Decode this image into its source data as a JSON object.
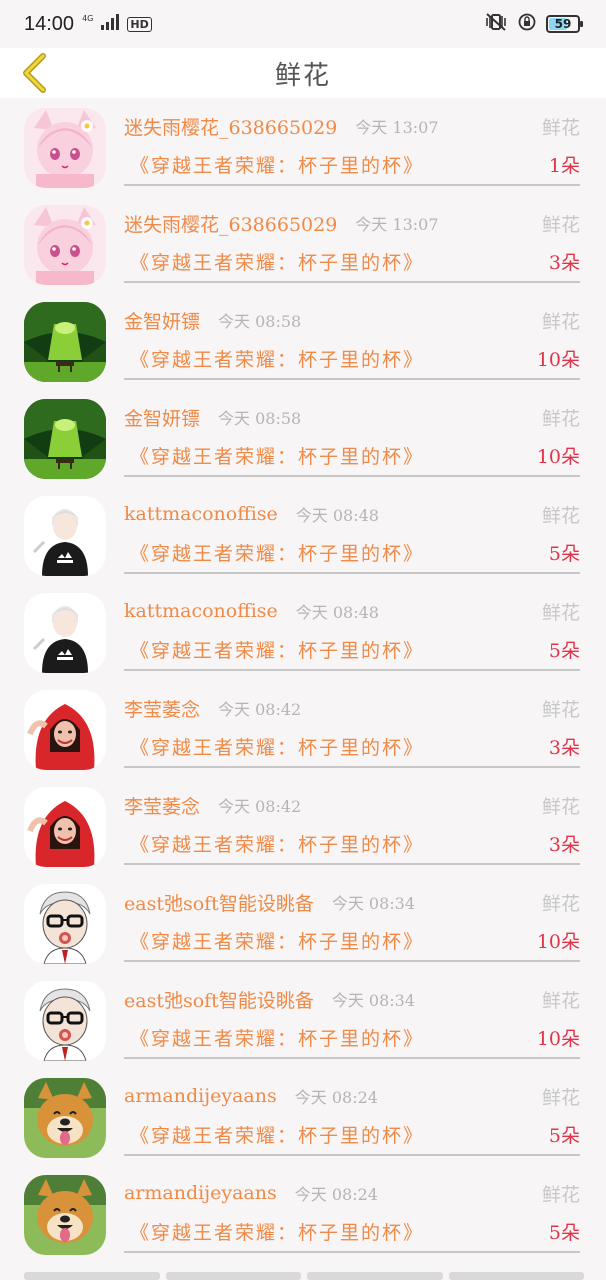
{
  "status_bar": {
    "time": "14:00",
    "network_type": "4G",
    "hd_label": "HD",
    "battery": "59",
    "battery_level": 0.59
  },
  "header": {
    "title": "鲜花",
    "back_icon": "chevron-left-icon"
  },
  "colors": {
    "accent": "#f08a46",
    "count": "#e0344b",
    "muted": "#b5b5b5"
  },
  "items": [
    {
      "username": "迷失雨樱花_638665029",
      "time": "今天 13:07",
      "gift": "鲜花",
      "book": "《穿越王者荣耀：杯子里的杯》",
      "count": "1朵",
      "avatar": "anime-girl-avatar"
    },
    {
      "username": "迷失雨樱花_638665029",
      "time": "今天 13:07",
      "gift": "鲜花",
      "book": "《穿越王者荣耀：杯子里的杯》",
      "count": "3朵",
      "avatar": "anime-girl-avatar"
    },
    {
      "username": "金智妍镖",
      "time": "今天 08:58",
      "gift": "鲜花",
      "book": "《穿越王者荣耀：杯子里的杯》",
      "count": "10朵",
      "avatar": "forest-avatar"
    },
    {
      "username": "金智妍镖",
      "time": "今天 08:58",
      "gift": "鲜花",
      "book": "《穿越王者荣耀：杯子里的杯》",
      "count": "10朵",
      "avatar": "forest-avatar"
    },
    {
      "username": "kattmaconoffise",
      "time": "今天 08:48",
      "gift": "鲜花",
      "book": "《穿越王者荣耀：杯子里的杯》",
      "count": "5朵",
      "avatar": "man-avatar"
    },
    {
      "username": "kattmaconoffise",
      "time": "今天 08:48",
      "gift": "鲜花",
      "book": "《穿越王者荣耀：杯子里的杯》",
      "count": "5朵",
      "avatar": "man-avatar"
    },
    {
      "username": "李莹萎念",
      "time": "今天 08:42",
      "gift": "鲜花",
      "book": "《穿越王者荣耀：杯子里的杯》",
      "count": "3朵",
      "avatar": "woman-red-hood-avatar"
    },
    {
      "username": "李莹萎念",
      "time": "今天 08:42",
      "gift": "鲜花",
      "book": "《穿越王者荣耀：杯子里的杯》",
      "count": "3朵",
      "avatar": "woman-red-hood-avatar"
    },
    {
      "username": "east弛soft智能设眺备",
      "time": "今天 08:34",
      "gift": "鲜花",
      "book": "《穿越王者荣耀：杯子里的杯》",
      "count": "10朵",
      "avatar": "cartoon-man-glasses-avatar"
    },
    {
      "username": "east弛soft智能设眺备",
      "time": "今天 08:34",
      "gift": "鲜花",
      "book": "《穿越王者荣耀：杯子里的杯》",
      "count": "10朵",
      "avatar": "cartoon-man-glasses-avatar"
    },
    {
      "username": "armandijeyaans",
      "time": "今天 08:24",
      "gift": "鲜花",
      "book": "《穿越王者荣耀：杯子里的杯》",
      "count": "5朵",
      "avatar": "shiba-dog-avatar"
    },
    {
      "username": "armandijeyaans",
      "time": "今天 08:24",
      "gift": "鲜花",
      "book": "《穿越王者荣耀：杯子里的杯》",
      "count": "5朵",
      "avatar": "shiba-dog-avatar"
    }
  ]
}
